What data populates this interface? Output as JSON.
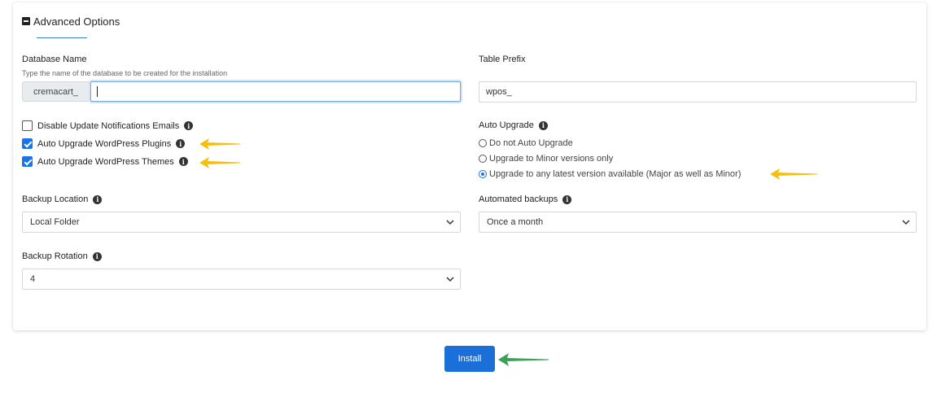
{
  "section": {
    "title": "Advanced Options"
  },
  "database": {
    "label": "Database Name",
    "hint": "Type the name of the database to be created for the installation",
    "prefix": "cremacart_",
    "value": ""
  },
  "table_prefix": {
    "label": "Table Prefix",
    "value": "wpos_"
  },
  "checkboxes": [
    {
      "label": "Disable Update Notifications Emails",
      "checked": false
    },
    {
      "label": "Auto Upgrade WordPress Plugins",
      "checked": true
    },
    {
      "label": "Auto Upgrade WordPress Themes",
      "checked": true
    }
  ],
  "auto_upgrade": {
    "label": "Auto Upgrade",
    "options": [
      {
        "label": "Do not Auto Upgrade",
        "selected": false
      },
      {
        "label": "Upgrade to Minor versions only",
        "selected": false
      },
      {
        "label": "Upgrade to any latest version available (Major as well as Minor)",
        "selected": true
      }
    ]
  },
  "backup_location": {
    "label": "Backup Location",
    "value": "Local Folder"
  },
  "automated_backups": {
    "label": "Automated backups",
    "value": "Once a month"
  },
  "backup_rotation": {
    "label": "Backup Rotation",
    "value": "4"
  },
  "install": {
    "label": "Install"
  },
  "colors": {
    "accent": "#1a6fd8",
    "highlight_arrow": "#f5bf0f",
    "install_arrow": "#3aa057"
  }
}
